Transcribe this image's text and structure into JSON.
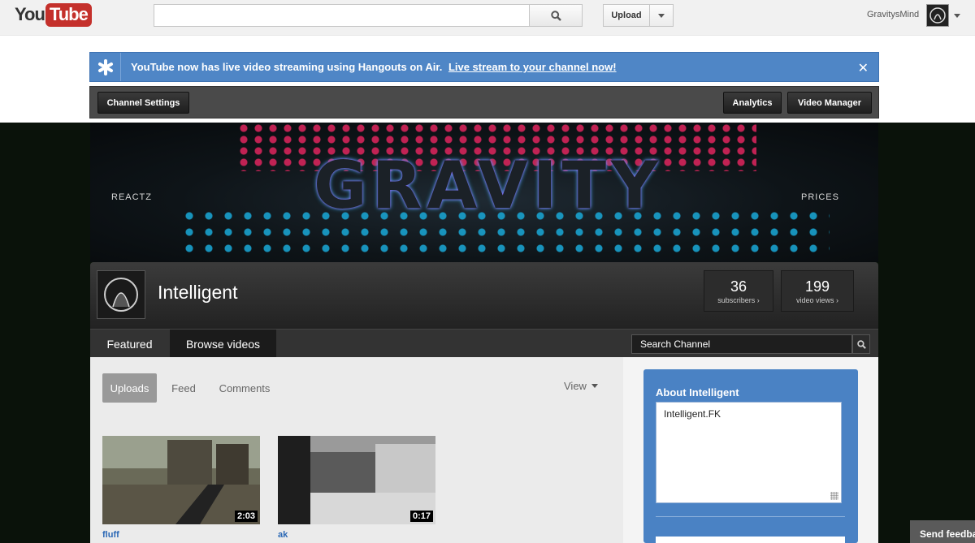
{
  "masthead": {
    "logo_you": "You",
    "logo_tube": "Tube",
    "search_placeholder": "",
    "upload_label": "Upload",
    "username": "GravitysMind"
  },
  "alert": {
    "message": "YouTube now has live video streaming using Hangouts on Air.",
    "link": "Live stream to your channel now!",
    "close": "✕"
  },
  "owner_bar": {
    "channel_settings": "Channel Settings",
    "analytics": "Analytics",
    "video_manager": "Video Manager"
  },
  "banner": {
    "left_label": "REACTZ",
    "right_label": "PRICES",
    "title": "GRAVITY"
  },
  "channel": {
    "name": "Intelligent",
    "stats": [
      {
        "value": "36",
        "label": "subscribers ›"
      },
      {
        "value": "199",
        "label": "video views ›"
      }
    ]
  },
  "nav": {
    "tabs": [
      {
        "label": "Featured",
        "active": false
      },
      {
        "label": "Browse videos",
        "active": true
      }
    ],
    "search_placeholder": "Search Channel"
  },
  "content": {
    "sub_tabs": [
      {
        "label": "Uploads",
        "active": true
      },
      {
        "label": "Feed",
        "active": false
      },
      {
        "label": "Comments",
        "active": false
      }
    ],
    "view_label": "View",
    "videos": [
      {
        "title": "fluff",
        "duration": "2:03"
      },
      {
        "title": "ak",
        "duration": "0:17"
      }
    ]
  },
  "sidebar": {
    "about_title": "About Intelligent",
    "about_text": "Intelligent.FK"
  },
  "feedback_label": "Send feedback",
  "colors": {
    "brand_red": "#c4302b",
    "alert_blue": "#4f86c6",
    "link_blue": "#2b68b5"
  }
}
